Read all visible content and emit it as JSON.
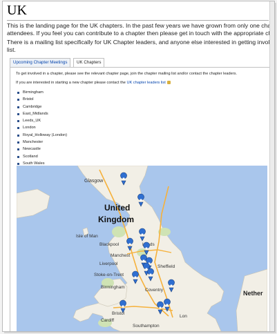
{
  "page": {
    "title": "UK",
    "paragraphs": [
      "This is the landing page for the UK chapters. In the past few years we have grown from only one chapter to seven",
      "attendees. If you feel you can contribute to a chapter then please get in touch with the appropriate chapter leaders",
      "There is a mailing list specifically for UK Chapter leaders, and anyone else interested in getting involved with cha",
      "list."
    ]
  },
  "tabs": [
    {
      "label": "Upcoming Chapter Meetings"
    },
    {
      "label": "UK Chapters"
    }
  ],
  "panel": {
    "intro": "To get involved in a chapter, please see the relevant chapter page, join the chapter mailing list and/or contact the chapter leaders.",
    "start_text": "If you are interested in starting a new chapter please contact the",
    "start_link": "UK chapter leaders list",
    "chapters": [
      "Birmingham",
      "Bristol",
      "Cambridge",
      "East_Midlands",
      "Leeds_UK",
      "London",
      "Royal_Holloway (London)",
      "Manchester",
      "Newcastle",
      "Scotland",
      "South Wales"
    ]
  },
  "map": {
    "labels": {
      "glasgow": "Glasgow",
      "united": "United",
      "kingdom": "Kingdom",
      "isle_of_man": "Isle of Man",
      "blackpool": "Blackpool",
      "manchester": "Manchest",
      "leeds": "Leeds",
      "sheffield": "Sheffield",
      "liverpool": "Liverpool",
      "stoke": "Stoke-on-Trent",
      "birmingham": "Birmingham",
      "coventry": "Coventry",
      "bristol": "Bristol",
      "cardiff": "Cardiff",
      "southampton": "Southampton",
      "london": "Lon",
      "nether": "Nether"
    },
    "colors": {
      "sea": "#a9c6ec",
      "land": "#f2efe6",
      "park": "#cfe3b4",
      "road": "#f6b13b",
      "marker": "#2f6fd1"
    }
  }
}
